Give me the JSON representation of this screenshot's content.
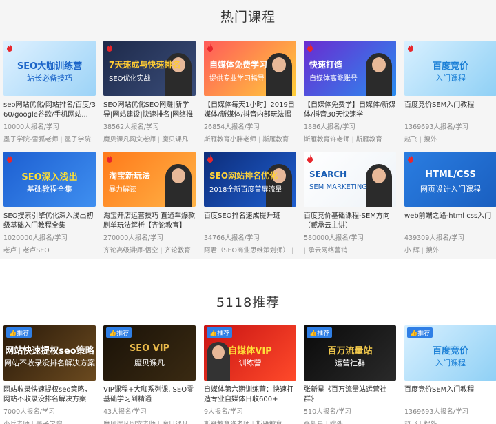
{
  "hot": {
    "title": "热门课程",
    "courses": [
      {
        "title": "seo网站优化/网站排名/百度/360/google谷歌/手机网站...",
        "count": "10000人报名/学习",
        "teacher": "墨子学院-雪狐老师",
        "org": "墨子学院",
        "thumb": {
          "bg": "linear-gradient(135deg,#dff1ff,#9cd3f7)",
          "line1": "SEO大咖训练营",
          "line2": "站长必备技巧",
          "color1": "#1b64c8"
        }
      },
      {
        "title": "SEO网站优化SEO网赚|新学导|网站建设|快速排名|网络推广...",
        "count": "38562人报名/学习",
        "teacher": "魔贝课凡网文老师",
        "org": "魔贝课凡",
        "thumb": {
          "bg": "linear-gradient(135deg,#1e2a4a,#3a4d7a)",
          "line1": "7天速成与快速排名",
          "line2": "SEO优化实战",
          "color1": "#ffcc33"
        }
      },
      {
        "title": "【自媒体每天1小时】2019自媒体/新媒体/抖音内部玩法揭秘",
        "count": "26854人报名/学习",
        "teacher": "斯雁教育小胖老师",
        "org": "斯雁教育",
        "thumb": {
          "bg": "linear-gradient(135deg,#ff5a5a,#ffcf3a)",
          "line1": "自媒体免费学习",
          "line2": "提供专业学习指导",
          "color1": "#ffffff"
        }
      },
      {
        "title": "【自媒体免费学】自媒体/新媒体/抖音30天快速学",
        "count": "1886人报名/学习",
        "teacher": "斯雁教育许老师",
        "org": "斯雁教育",
        "thumb": {
          "bg": "linear-gradient(135deg,#6a2bd0,#2a8df0)",
          "line1": "快速打造",
          "line2": "自媒体高能账号",
          "color1": "#ffffff"
        }
      },
      {
        "title": "百度竞价SEM入门教程",
        "count": "1369693人报名/学习",
        "teacher": "赵飞",
        "org": "搜外",
        "thumb": {
          "bg": "linear-gradient(135deg,#d8f0ff,#8fd0f5)",
          "line1": "百度竞价",
          "line2": "入门课程",
          "color1": "#1a7fd6"
        }
      },
      {
        "title": "SEO搜索引擎优化深入浅出初级基础入门教程全集",
        "count": "1020000人报名/学习",
        "teacher": "老卢",
        "org": "老卢SEO",
        "thumb": {
          "bg": "linear-gradient(135deg,#1d5fd1,#3f8ff0)",
          "line1": "SEO深入浅出",
          "line2": "基础教程全集",
          "color1": "#ffe033"
        }
      },
      {
        "title": "淘宝开店运营技巧 直通车爆款刷单玩法解析【齐论教育】",
        "count": "270000人报名/学习",
        "teacher": "齐论高级讲师-悟空",
        "org": "齐论教育",
        "thumb": {
          "bg": "linear-gradient(135deg,#ff7a1a,#ffb347)",
          "line1": "淘宝新玩法",
          "line2": "暴力解读",
          "color1": "#ffffff"
        }
      },
      {
        "title": "百度SEO排名速成提升班",
        "count": "34766人报名/学习",
        "teacher": "阿君（SEO商业思维策划师）",
        "org": "",
        "thumb": {
          "bg": "linear-gradient(135deg,#0d2d7a,#1f5fd0)",
          "line1": "SEO网站排名优化",
          "line2": "2018全新百度首屏流量",
          "color1": "#ffd23a"
        }
      },
      {
        "title": "百度竞价基础课程-SEM方向（臧承云主讲）",
        "count": "580000人报名/学习",
        "teacher": "",
        "org": "承云网络营销",
        "thumb": {
          "bg": "linear-gradient(135deg,#ffffff,#eef3f8)",
          "line1": "SEARCH",
          "line2": "SEM  MARKETING",
          "color1": "#1b5fb5"
        }
      },
      {
        "title": "web前端之路-html css入门",
        "count": "439309人报名/学习",
        "teacher": "小 辉",
        "org": "搜外",
        "thumb": {
          "bg": "linear-gradient(135deg,#2a7de1,#1a5fc0)",
          "line1": "HTML/CSS",
          "line2": "网页设计入门课程",
          "color1": "#ffffff"
        }
      }
    ]
  },
  "recommend": {
    "title": "5118推荐",
    "badge": "推荐",
    "courses": [
      {
        "title": "网站收录快速提权seo策略，网站不收录没排名解决方案",
        "count": "7000人报名/学习",
        "teacher": "小兵老师",
        "org": "墨子学院",
        "thumb": {
          "bg": "linear-gradient(135deg,#2a1a0a,#6b4a1f)",
          "line1": "网站快速提权seo策略",
          "line2": "网站不收录没排名解决方案",
          "color1": "#ffffff"
        }
      },
      {
        "title": "VIP课程+大咖系列课, SEO零基础学习到精通",
        "count": "43人报名/学习",
        "teacher": "魔贝课凡网文老师",
        "org": "魔贝课凡",
        "thumb": {
          "bg": "linear-gradient(135deg,#1a1208,#3a2a12)",
          "line1": "SEO VIP",
          "line2": "魔贝课凡",
          "color1": "#e8b84a"
        }
      },
      {
        "title": "自媒体第六期训练营：快速打造专业自媒体日收600+",
        "count": "9人报名/学习",
        "teacher": "斯雁教育许老师",
        "org": "斯雁教育",
        "thumb": {
          "bg": "linear-gradient(135deg,#c81414,#ff4a2a)",
          "line1": "自媒体VIP",
          "line2": "训练营",
          "color1": "#ffdf3a"
        }
      },
      {
        "title": "张新星《百万流量站运营社群》",
        "count": "510人报名/学习",
        "teacher": "张新星",
        "org": "搜外",
        "thumb": {
          "bg": "linear-gradient(135deg,#0a0a0a,#2a2a2a)",
          "line1": "百万流量站",
          "line2": "运营社群",
          "color1": "#f2c94c"
        }
      },
      {
        "title": "百度竞价SEM入门教程",
        "count": "1369693人报名/学习",
        "teacher": "赵飞",
        "org": "搜外",
        "thumb": {
          "bg": "linear-gradient(135deg,#d8f0ff,#8fd0f5)",
          "line1": "百度竞价",
          "line2": "入门课程",
          "color1": "#1a7fd6"
        }
      }
    ]
  }
}
